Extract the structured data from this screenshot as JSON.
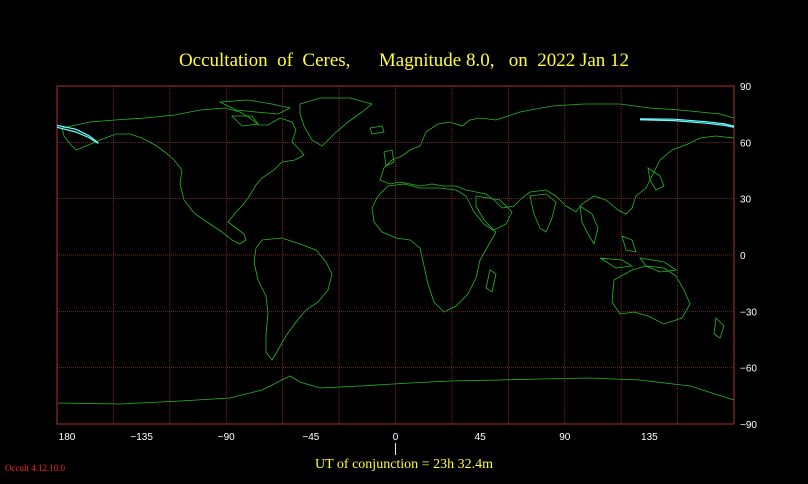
{
  "title": "Occultation  of  Ceres,      Magnitude 8.0,   on  2022 Jan 12",
  "ut_label": "UT of conjunction = 23h 32.4m",
  "version": "Occult 4.12.10.0",
  "colors": {
    "grid": "#b03030",
    "coast": "#22bb22",
    "track": "#66ffff",
    "text": "#ffff33",
    "version": "#ff2222"
  },
  "map": {
    "lon_range": [
      -180,
      180
    ],
    "lat_range": [
      -90,
      90
    ],
    "lon_ticks": [
      180,
      -135,
      -90,
      -45,
      0,
      45,
      90,
      135
    ],
    "lon_tick_labels": [
      "180",
      "−135",
      "−90",
      "−45",
      "0",
      "45",
      "90",
      "135"
    ],
    "lat_ticks": [
      90,
      60,
      30,
      0,
      -30,
      -60,
      -90
    ],
    "lat_tick_labels": [
      "90",
      "60",
      "30",
      "0",
      "−30",
      "−60",
      "−90"
    ]
  },
  "tracks": [
    {
      "points": [
        [
          -180,
          69
        ],
        [
          -170,
          67
        ],
        [
          -163,
          63.5
        ],
        [
          -159,
          60.5
        ],
        [
          -158,
          59.5
        ]
      ]
    },
    {
      "points": [
        [
          -180,
          68
        ],
        [
          -170,
          65.5
        ],
        [
          -163,
          62.5
        ],
        [
          -159,
          60
        ],
        [
          -158,
          59.5
        ]
      ]
    },
    {
      "points": [
        [
          130,
          72.5
        ],
        [
          148,
          72.3
        ],
        [
          165,
          71
        ],
        [
          175,
          69.8
        ],
        [
          180,
          68.6
        ]
      ]
    },
    {
      "points": [
        [
          130,
          72
        ],
        [
          148,
          71.6
        ],
        [
          165,
          70.2
        ],
        [
          175,
          69
        ],
        [
          180,
          68
        ]
      ]
    }
  ]
}
